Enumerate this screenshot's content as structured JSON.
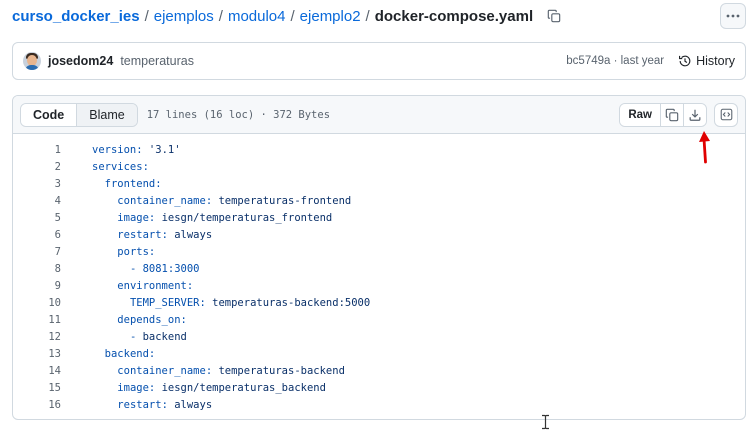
{
  "breadcrumb": {
    "repo": "curso_docker_ies",
    "path": [
      "ejemplos",
      "modulo4",
      "ejemplo2"
    ],
    "separator": "/",
    "file": "docker-compose.yaml"
  },
  "commit": {
    "author": "josedom24",
    "message": "temperaturas",
    "sha_time": "bc5749a · last year",
    "history_label": "History"
  },
  "file_header": {
    "tabs": [
      {
        "label": "Code",
        "active": true
      },
      {
        "label": "Blame",
        "active": false
      }
    ],
    "info": "17 lines (16 loc) · 372 Bytes",
    "raw_label": "Raw"
  },
  "code": {
    "lines": [
      {
        "n": "1",
        "indent": "",
        "key": "version",
        "sep": ": ",
        "value": "'3.1'"
      },
      {
        "n": "2",
        "indent": "",
        "key": "services",
        "sep": ":",
        "value": ""
      },
      {
        "n": "3",
        "indent": "  ",
        "key": "frontend",
        "sep": ":",
        "value": ""
      },
      {
        "n": "4",
        "indent": "    ",
        "key": "container_name",
        "sep": ": ",
        "value": "temperaturas-frontend"
      },
      {
        "n": "5",
        "indent": "    ",
        "key": "image",
        "sep": ": ",
        "value": "iesgn/temperaturas_frontend"
      },
      {
        "n": "6",
        "indent": "    ",
        "key": "restart",
        "sep": ": ",
        "value": "always"
      },
      {
        "n": "7",
        "indent": "    ",
        "key": "ports",
        "sep": ":",
        "value": ""
      },
      {
        "n": "8",
        "indent": "      ",
        "key": "- 8081:3000",
        "sep": "",
        "value": ""
      },
      {
        "n": "9",
        "indent": "    ",
        "key": "environment",
        "sep": ":",
        "value": ""
      },
      {
        "n": "10",
        "indent": "      ",
        "key": "TEMP_SERVER",
        "sep": ": ",
        "value": "temperaturas-backend:5000"
      },
      {
        "n": "11",
        "indent": "    ",
        "key": "depends_on",
        "sep": ":",
        "value": ""
      },
      {
        "n": "12",
        "indent": "      ",
        "key": "- ",
        "sep": "",
        "value": "backend"
      },
      {
        "n": "13",
        "indent": "  ",
        "key": "backend",
        "sep": ":",
        "value": ""
      },
      {
        "n": "14",
        "indent": "    ",
        "key": "container_name",
        "sep": ": ",
        "value": "temperaturas-backend"
      },
      {
        "n": "15",
        "indent": "    ",
        "key": "image",
        "sep": ": ",
        "value": "iesgn/temperaturas_backend"
      },
      {
        "n": "16",
        "indent": "    ",
        "key": "restart",
        "sep": ": ",
        "value": "always"
      }
    ]
  },
  "icons": {
    "copy_path": "copy-icon",
    "more": "kebab-horizontal-icon",
    "history": "history-icon",
    "copy_raw": "copy-icon",
    "download": "download-icon",
    "symbols": "code-square-icon",
    "annotation": "red-arrow-icon",
    "cursor": "text-cursor-icon"
  },
  "colors": {
    "link": "#0969da",
    "key": "#0550ae",
    "value": "#0a3069",
    "annotation": "#e00000"
  }
}
